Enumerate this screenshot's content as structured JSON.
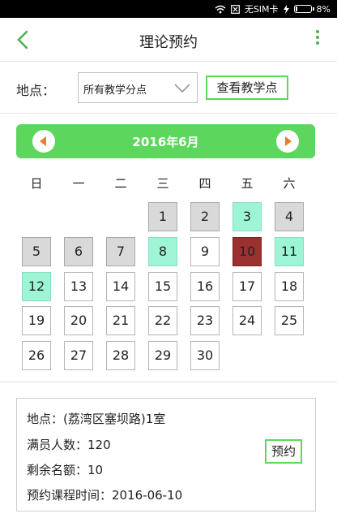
{
  "status_bar": {
    "sim_text": "无SIM卡",
    "battery_text": "8%",
    "icons": [
      "wifi-icon",
      "sim-icon",
      "charging-icon",
      "battery-icon"
    ]
  },
  "header": {
    "title": "理论预约",
    "back_icon": "chevron-left-icon",
    "more_icon": "more-vertical-icon"
  },
  "location": {
    "label": "地点：",
    "selected_option": "所有教学分点",
    "view_button_label": "查看教学点"
  },
  "calendar": {
    "month_label": "2016年6月",
    "weekdays": [
      "日",
      "一",
      "二",
      "三",
      "四",
      "五",
      "六"
    ],
    "first_weekday_index": 3,
    "days": [
      {
        "day": "1",
        "status": "gray"
      },
      {
        "day": "2",
        "status": "gray"
      },
      {
        "day": "3",
        "status": "mint"
      },
      {
        "day": "4",
        "status": "gray"
      },
      {
        "day": "5",
        "status": "gray"
      },
      {
        "day": "6",
        "status": "gray"
      },
      {
        "day": "7",
        "status": "gray"
      },
      {
        "day": "8",
        "status": "mint"
      },
      {
        "day": "9",
        "status": "normal"
      },
      {
        "day": "10",
        "status": "selected"
      },
      {
        "day": "11",
        "status": "mint"
      },
      {
        "day": "12",
        "status": "mint"
      },
      {
        "day": "13",
        "status": "normal"
      },
      {
        "day": "14",
        "status": "normal"
      },
      {
        "day": "15",
        "status": "normal"
      },
      {
        "day": "16",
        "status": "normal"
      },
      {
        "day": "17",
        "status": "normal"
      },
      {
        "day": "18",
        "status": "normal"
      },
      {
        "day": "19",
        "status": "normal"
      },
      {
        "day": "20",
        "status": "normal"
      },
      {
        "day": "21",
        "status": "normal"
      },
      {
        "day": "22",
        "status": "normal"
      },
      {
        "day": "23",
        "status": "normal"
      },
      {
        "day": "24",
        "status": "normal"
      },
      {
        "day": "25",
        "status": "normal"
      },
      {
        "day": "26",
        "status": "normal"
      },
      {
        "day": "27",
        "status": "normal"
      },
      {
        "day": "28",
        "status": "normal"
      },
      {
        "day": "29",
        "status": "normal"
      },
      {
        "day": "30",
        "status": "normal"
      }
    ],
    "colors": {
      "header_green": "#5cd65c",
      "gray": "#d9d9d9",
      "mint": "#9ef5d5",
      "selected": "#9b3030",
      "nav_arrow": "#f27b20"
    }
  },
  "info": {
    "location_line": "地点：(荔湾区塞坝路)1室",
    "capacity_line": "满员人数：120",
    "remaining_line": "剩余名额：10",
    "course_time_line": "预约课程时间：2016-06-10",
    "reserve_button_label": "预约"
  }
}
